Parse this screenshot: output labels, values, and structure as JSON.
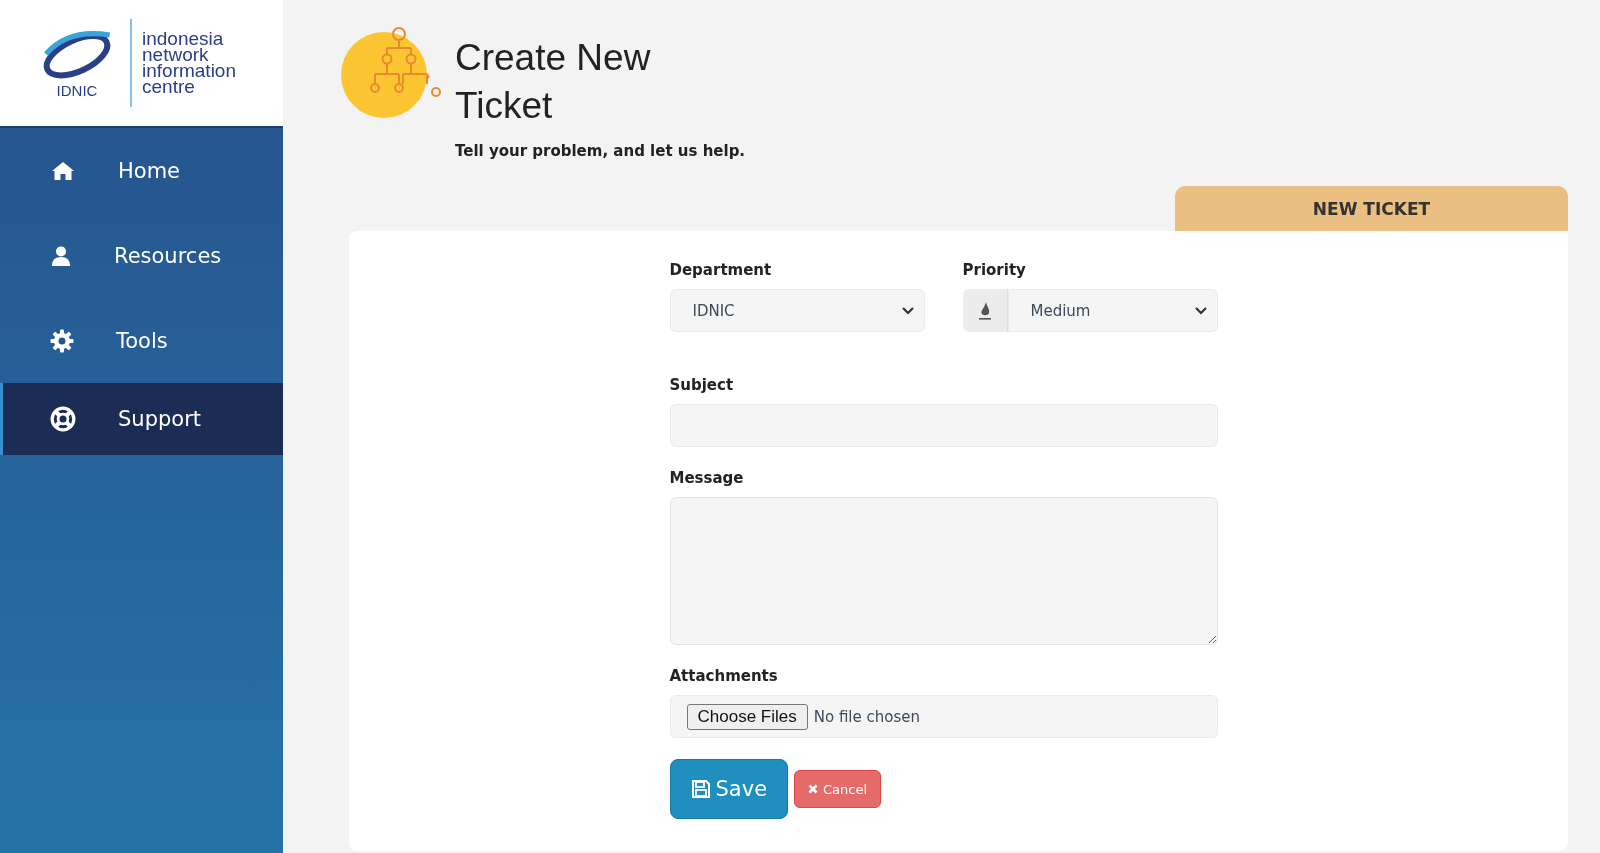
{
  "logo": {
    "abbr": "IDNIC",
    "name_lines": [
      "indonesia",
      "network",
      "information",
      "centre"
    ]
  },
  "sidebar": {
    "items": [
      {
        "label": "Home",
        "kind": "home",
        "selected": false
      },
      {
        "label": "Resources",
        "kind": "user",
        "selected": false
      },
      {
        "label": "Tools",
        "kind": "gear",
        "selected": false
      },
      {
        "label": "Support",
        "kind": "lifebuoy",
        "selected": true
      }
    ]
  },
  "header": {
    "title": "Create New Ticket",
    "subtitle": "Tell your problem, and let us help."
  },
  "tab": {
    "label": "NEW TICKET"
  },
  "form": {
    "department": {
      "label": "Department",
      "value": "IDNIC"
    },
    "priority": {
      "label": "Priority",
      "value": "Medium"
    },
    "subject": {
      "label": "Subject"
    },
    "message": {
      "label": "Message"
    },
    "attachments": {
      "label": "Attachments",
      "button": "Choose Files",
      "status": "No file chosen"
    }
  },
  "buttons": {
    "save": "Save",
    "cancel": "Cancel"
  }
}
